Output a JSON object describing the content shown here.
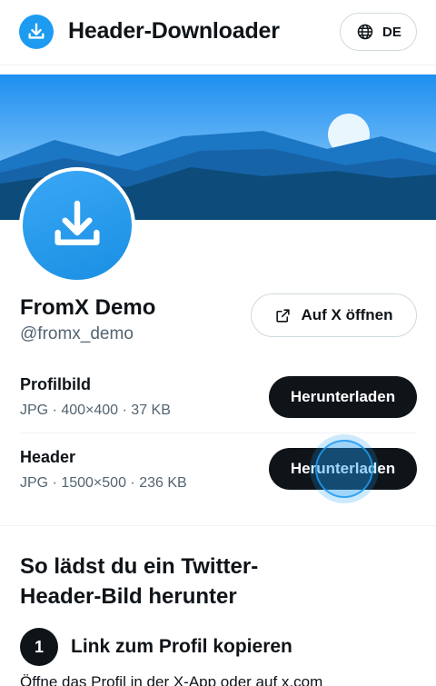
{
  "header": {
    "app_title": "Header-Downloader",
    "lang_label": "DE",
    "logo_icon": "download-icon",
    "lang_icon": "globe-icon"
  },
  "profile": {
    "display_name": "FromX Demo",
    "handle": "@fromx_demo",
    "open_button_label": "Auf X öffnen",
    "open_icon": "external-link-icon"
  },
  "files": [
    {
      "title": "Profilbild",
      "meta": "JPG · 400×400 · 37 KB",
      "button_label": "Herunterladen"
    },
    {
      "title": "Header",
      "meta": "JPG · 1500×500 · 236 KB",
      "button_label": "Herunterladen"
    }
  ],
  "howto": {
    "title": "So lädst du ein Twitter-Header-Bild herunter",
    "steps": [
      {
        "number": "1",
        "title": "Link zum Profil kopieren",
        "description": "Öffne das Profil in der X-App oder auf x.com"
      }
    ]
  },
  "colors": {
    "accent": "#1d9bf0",
    "button_dark": "#0f1419",
    "muted_text": "#536471"
  }
}
